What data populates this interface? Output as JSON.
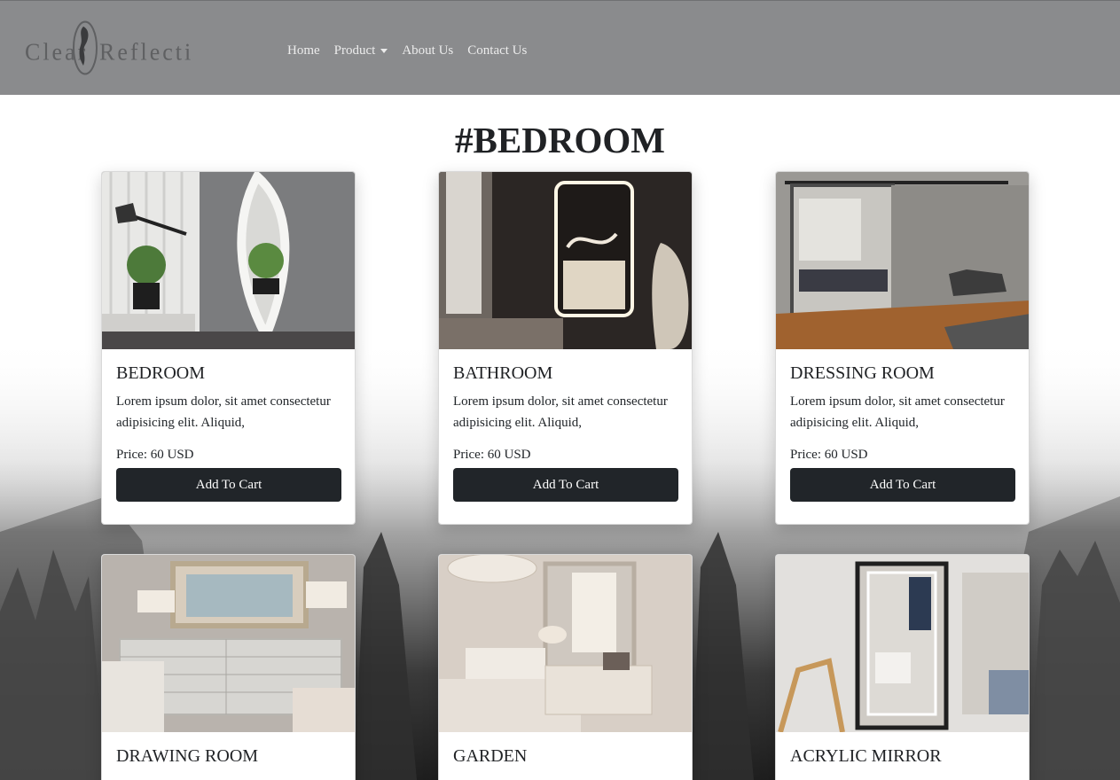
{
  "navbar": {
    "brand": "Clear Reflection",
    "links": [
      {
        "label": "Home"
      },
      {
        "label": "Product",
        "dropdown": true
      },
      {
        "label": "About Us"
      },
      {
        "label": "Contact Us"
      }
    ]
  },
  "page": {
    "title": "#BEDROOM"
  },
  "cards": [
    {
      "title": "BEDROOM",
      "text": "Lorem ipsum dolor, sit amet consectetur adipisicing elit. Aliquid,",
      "price": "Price: 60 USD",
      "button": "Add To Cart"
    },
    {
      "title": "BATHROOM",
      "text": "Lorem ipsum dolor, sit amet consectetur adipisicing elit. Aliquid,",
      "price": "Price: 60 USD",
      "button": "Add To Cart"
    },
    {
      "title": "DRESSING ROOM",
      "text": "Lorem ipsum dolor, sit amet consectetur adipisicing elit. Aliquid,",
      "price": "Price: 60 USD",
      "button": "Add To Cart"
    },
    {
      "title": "DRAWING ROOM"
    },
    {
      "title": "GARDEN"
    },
    {
      "title": "ACRYLIC MIRROR"
    }
  ],
  "colors": {
    "navbar_bg": "#8a8b8d",
    "button_bg": "#212529",
    "text": "#212529"
  }
}
